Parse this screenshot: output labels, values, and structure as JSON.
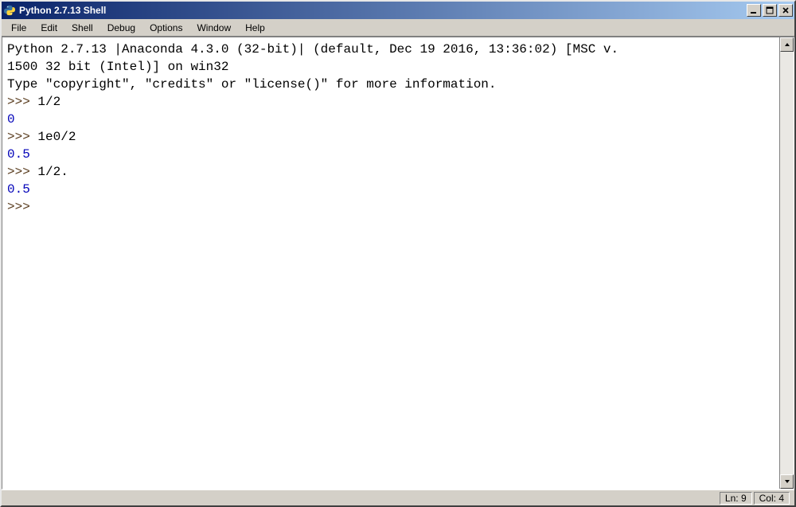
{
  "window": {
    "title": "Python 2.7.13 Shell"
  },
  "menu": {
    "items": [
      "File",
      "Edit",
      "Shell",
      "Debug",
      "Options",
      "Window",
      "Help"
    ]
  },
  "shell": {
    "banner_line1": "Python 2.7.13 |Anaconda 4.3.0 (32-bit)| (default, Dec 19 2016, 13:36:02) [MSC v.",
    "banner_line2": "1500 32 bit (Intel)] on win32",
    "banner_line3": "Type \"copyright\", \"credits\" or \"license()\" for more information.",
    "prompt": ">>> ",
    "entries": [
      {
        "input": "1/2",
        "output": "0"
      },
      {
        "input": "1e0/2",
        "output": "0.5"
      },
      {
        "input": "1/2.",
        "output": "0.5"
      }
    ]
  },
  "status": {
    "ln_label": "Ln:",
    "ln_value": "9",
    "col_label": "Col:",
    "col_value": "4"
  }
}
